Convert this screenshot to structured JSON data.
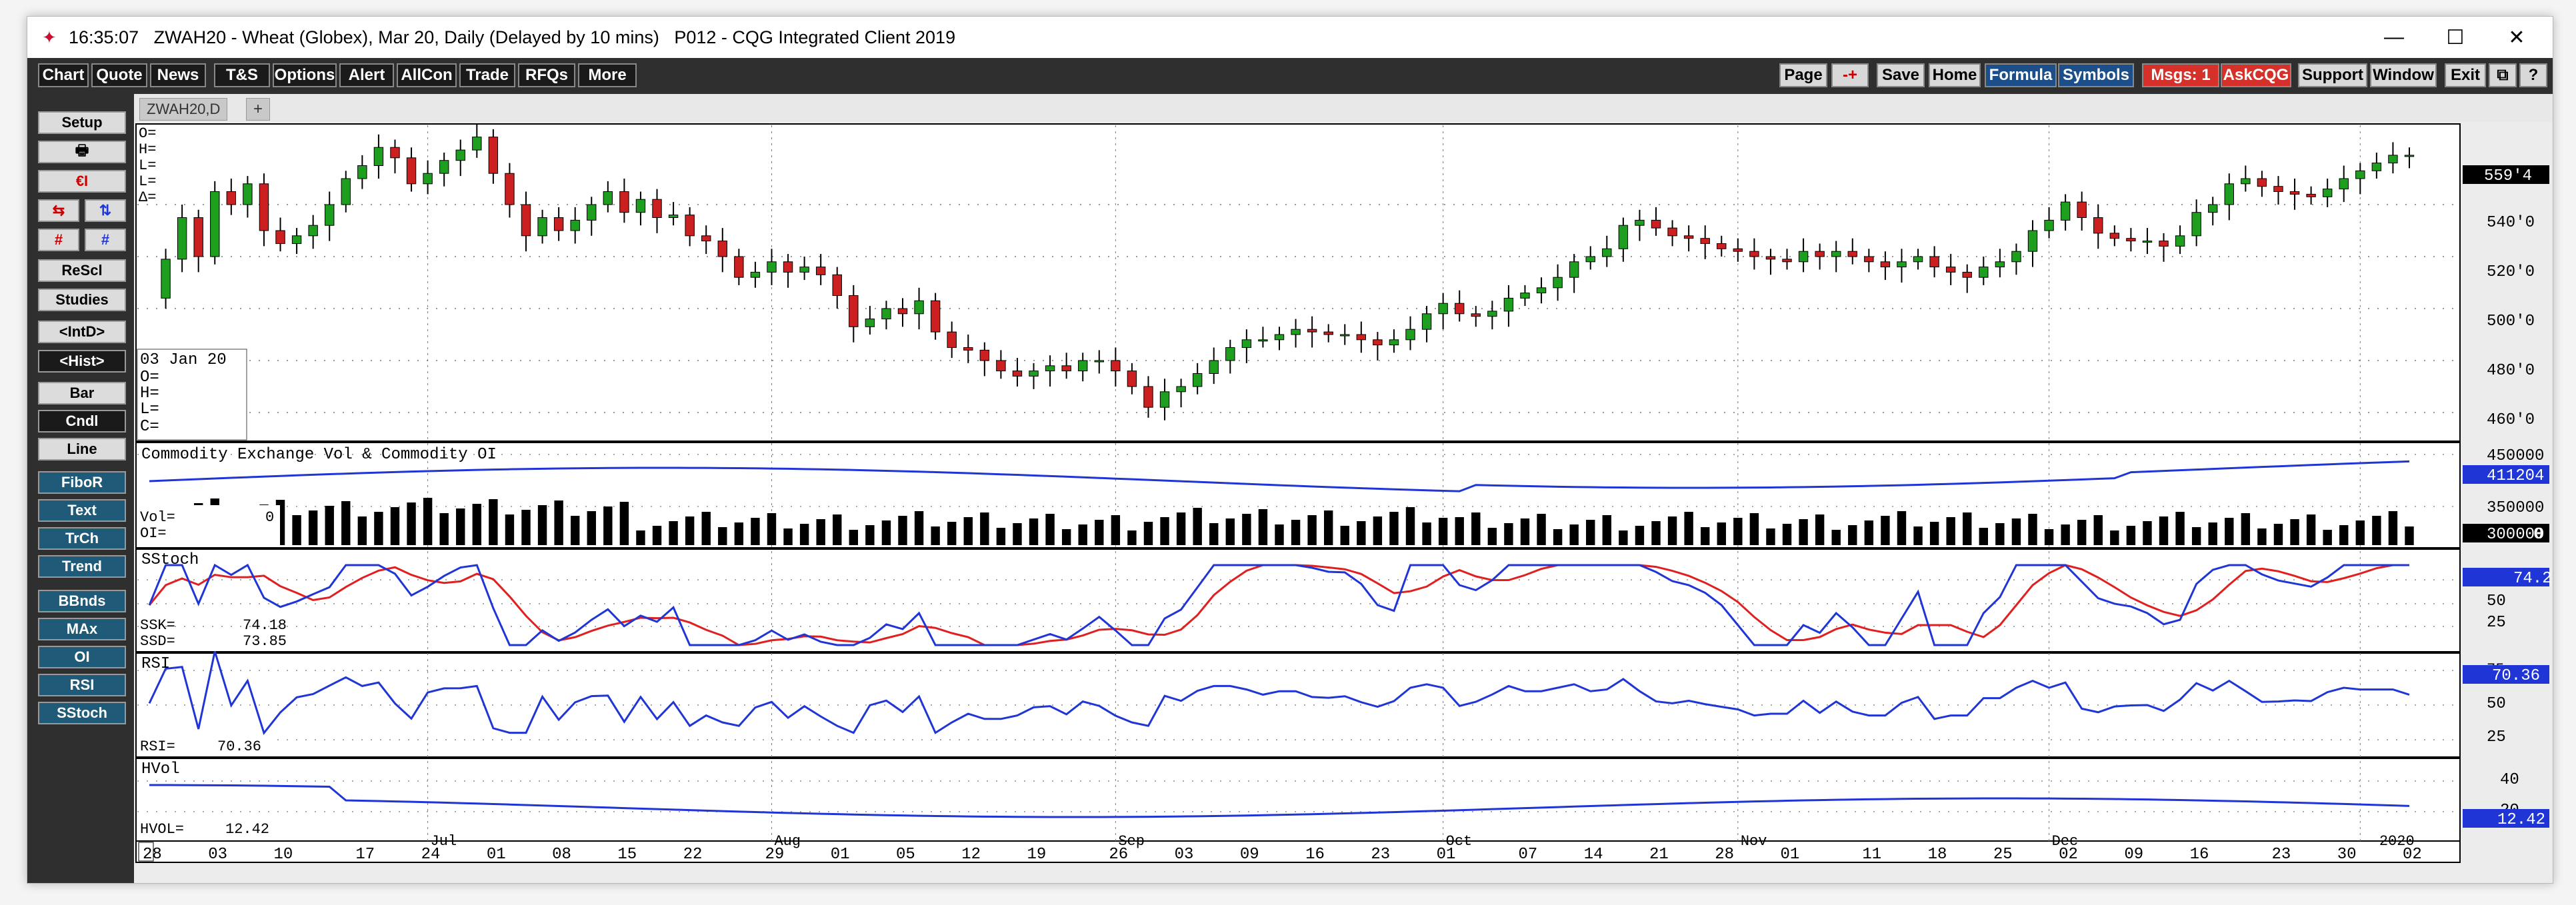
{
  "title_bar": {
    "text": "16:35:07   ZWAH20 - Wheat (Globex), Mar 20, Daily (Delayed by 10 mins)   P012 - CQG Integrated Client 2019",
    "minimize": "—",
    "maximize": "☐",
    "close": "✕"
  },
  "toolbar": {
    "left": [
      "Chart",
      "Quote",
      "News",
      "T&S",
      "Options",
      "Alert",
      "AllCon",
      "Trade",
      "RFQs",
      "More"
    ],
    "right": [
      "Page",
      "-+",
      "Save",
      "Home",
      "Formula",
      "Symbols",
      "Msgs: 1",
      "AskCQG",
      "Support",
      "Window",
      "Exit",
      "⧉",
      "?"
    ]
  },
  "sidebar": {
    "buttons": [
      "Setup",
      "🖶",
      "€I",
      "⇆",
      "⇅",
      "#",
      "#",
      "ReScl",
      "Studies",
      "<IntD>",
      "<Hist>",
      "Bar",
      "Cndl",
      "Line",
      "FiboR",
      "Text",
      "TrCh",
      "Trend",
      "BBnds",
      "MAx",
      "OI",
      "RSI",
      "SStoch"
    ]
  },
  "tab": {
    "label": "ZWAH20,D",
    "plus": "+"
  },
  "colors": {
    "up": "#1e9e1e",
    "down": "#cc1f1f",
    "blue": "#1f35d6",
    "red": "#e02020",
    "axis_bg": "#e6e6e6"
  },
  "price_panel": {
    "ohlc_labels": [
      "O=",
      "H=",
      "L=",
      "L=",
      "Δ="
    ],
    "info_date": "03 Jan 20",
    "info_labels": [
      "O=",
      "H=",
      "L=",
      "C="
    ],
    "y_ticks": [
      "540'0",
      "520'0",
      "500'0",
      "480'0",
      "460'0"
    ],
    "last_price": "559'4"
  },
  "vol_panel": {
    "title": "Commodity Exchange Vol & Commodity OI",
    "vol_label": "Vol=",
    "vol_value": "0",
    "oi_label": "OI=",
    "y_ticks": [
      "450000",
      "350000"
    ],
    "oi_last": "411204",
    "vol_last": "300000",
    "zero": "0"
  },
  "sstoch_panel": {
    "title": "SStoch",
    "ssk_label": "SSK=",
    "ssk_value": "74.18",
    "ssd_label": "SSD=",
    "ssd_value": "73.85",
    "y_ticks": [
      "50",
      "25"
    ],
    "last": "74.2"
  },
  "rsi_panel": {
    "title": "RSI",
    "rsi_label": "RSI=",
    "rsi_value": "70.36",
    "y_ticks": [
      "75",
      "50",
      "25"
    ],
    "last": "70.36"
  },
  "hvol_panel": {
    "title": "HVol",
    "hvol_label": "HVOL=",
    "hvol_value": "12.42",
    "y_ticks": [
      "40",
      "20"
    ],
    "last": "12.42"
  },
  "x_axis": {
    "days": [
      "28",
      "03",
      "10",
      "17",
      "24",
      "01",
      "08",
      "15",
      "22",
      "29",
      "01",
      "05",
      "12",
      "19",
      "26",
      "03",
      "09",
      "16",
      "23",
      "01",
      "07",
      "14",
      "21",
      "28",
      "01",
      "11",
      "18",
      "25",
      "02",
      "09",
      "16",
      "23",
      "30",
      "02"
    ],
    "months": [
      "Jul",
      "Aug",
      "Sep",
      "Oct",
      "Nov",
      "Dec",
      "2020"
    ]
  },
  "chart_data": {
    "type": "candlestick",
    "symbol": "ZWAH20",
    "ylim": [
      450,
      570
    ],
    "closes": [
      504,
      519,
      535,
      520,
      545,
      540,
      548,
      530,
      525,
      528,
      532,
      540,
      550,
      555,
      562,
      558,
      548,
      552,
      557,
      561,
      566,
      552,
      540,
      528,
      535,
      530,
      534,
      540,
      545,
      537,
      542,
      535,
      536,
      528,
      526,
      520,
      512,
      514,
      518,
      514,
      516,
      513,
      505,
      493,
      496,
      500,
      498,
      503,
      491,
      485,
      484,
      480,
      476,
      474,
      476,
      478,
      476,
      480,
      480,
      476,
      470,
      462,
      468,
      470,
      475,
      480,
      485,
      488,
      488,
      490,
      492,
      491,
      490,
      490,
      488,
      486,
      488,
      492,
      498,
      502,
      498,
      497,
      499,
      504,
      506,
      508,
      512,
      518,
      520,
      523,
      532,
      534,
      531,
      528,
      527,
      525,
      523,
      522,
      520,
      519,
      518,
      522,
      520,
      522,
      520,
      518,
      516,
      518,
      520,
      516,
      514,
      512,
      516,
      518,
      522,
      530,
      534,
      541,
      535,
      529,
      527,
      526,
      526,
      524,
      528,
      537,
      540,
      548,
      550,
      547,
      545,
      544,
      543,
      546,
      550,
      553,
      556,
      559,
      559
    ]
  }
}
